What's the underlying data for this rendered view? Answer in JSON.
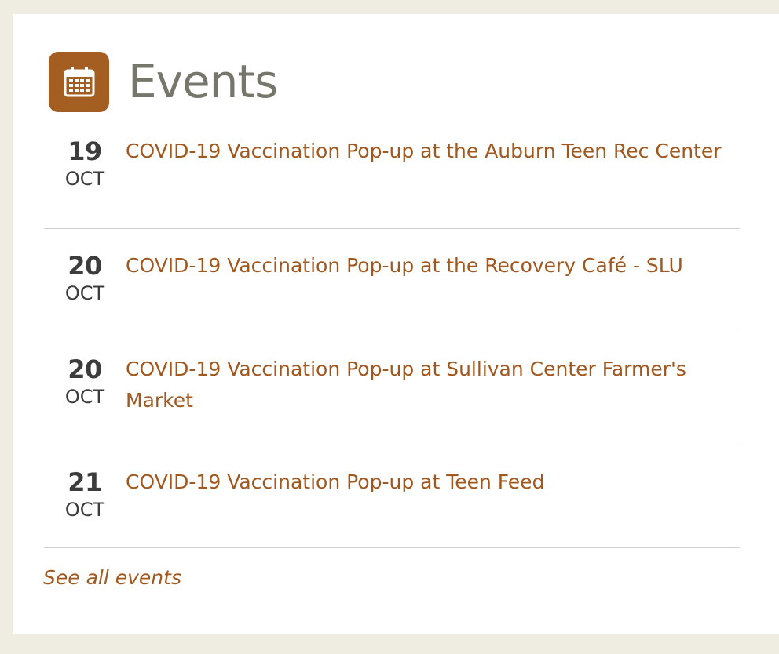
{
  "widget": {
    "title": "Events",
    "icon": "calendar-icon",
    "accent_color": "#a55e21",
    "link_color": "#a0581f"
  },
  "events": [
    {
      "day": "19",
      "month": "OCT",
      "title": "COVID-19 Vaccination Pop-up at the Auburn Teen Rec Center"
    },
    {
      "day": "20",
      "month": "OCT",
      "title": "COVID-19 Vaccination Pop-up at the Recovery Café - SLU"
    },
    {
      "day": "20",
      "month": "OCT",
      "title": "COVID-19 Vaccination Pop-up at Sullivan Center Farmer's Market"
    },
    {
      "day": "21",
      "month": "OCT",
      "title": "COVID-19 Vaccination Pop-up at Teen Feed"
    }
  ],
  "footer": {
    "see_all_label": "See all events"
  }
}
